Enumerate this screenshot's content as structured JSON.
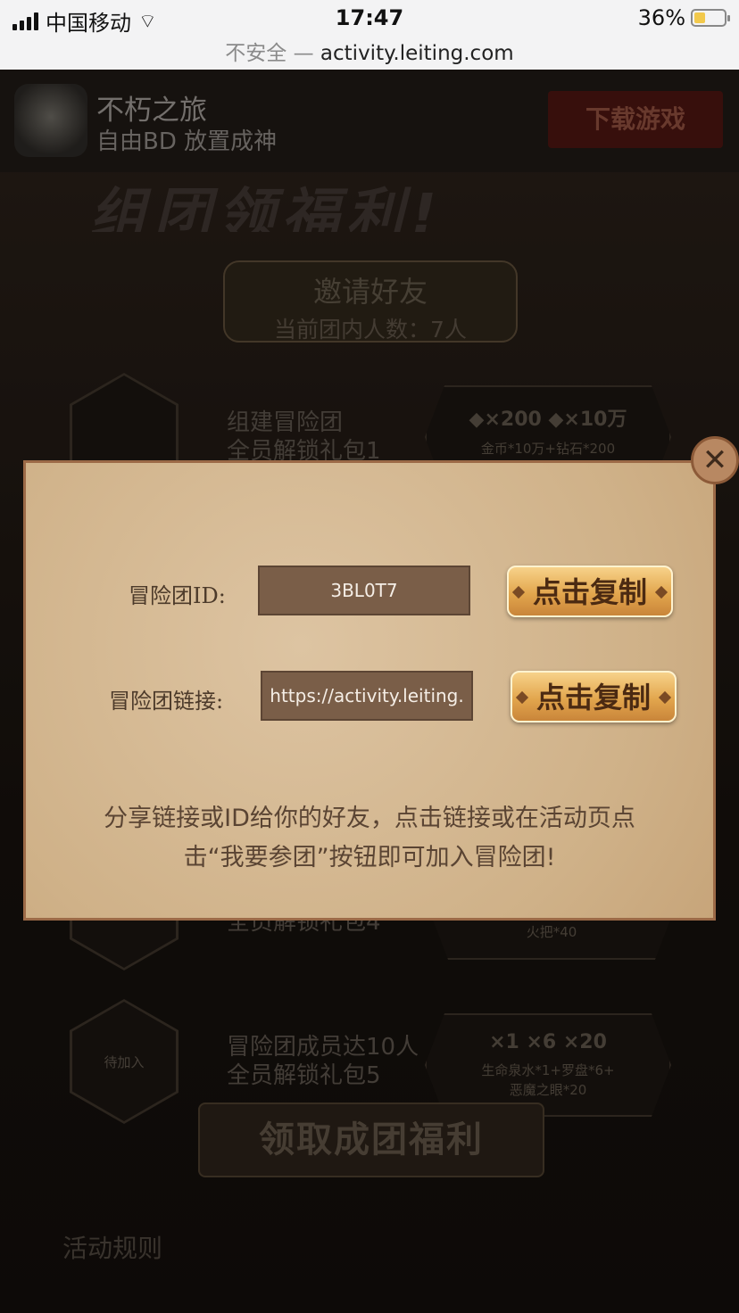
{
  "status_bar": {
    "carrier": "中国移动",
    "time": "17:47",
    "battery_text": "36%",
    "battery_level": 0.36,
    "url_insecure": "不安全",
    "url_sep": "—",
    "url_host": "activity.leiting.com"
  },
  "app_bar": {
    "name": "不朽之旅",
    "tagline": "自由BD 放置成神",
    "download_label": "下载游戏"
  },
  "background": {
    "banner": "组团领福利!",
    "invite_title": "邀请好友",
    "member_count": "当前团内人数：7人",
    "rows": [
      {
        "title": "组建冒险团",
        "subtitle": "全员解锁礼包1",
        "reward_icons": "◆×200  ◆×10万",
        "reward_desc": "金币*10万+钻石*200"
      },
      {
        "title": "",
        "subtitle": "全员解锁礼包4",
        "reward_icons": "",
        "reward_desc": "火把*40"
      },
      {
        "status": "待加入",
        "title": "冒险团成员达10人",
        "subtitle": "全员解锁礼包5",
        "reward_icons": "×1  ×6  ×20",
        "reward_desc_1": "生命泉水*1+罗盘*6+",
        "reward_desc_2": "恶魔之眼*20"
      }
    ],
    "claim_label": "领取成团福利",
    "rules_label": "活动规则"
  },
  "modal": {
    "team_id_label": "冒险团ID:",
    "team_id_value": "3BL0T7",
    "link_label": "冒险团链接:",
    "link_value": "https://activity.leiting.",
    "copy_label": "点击复制",
    "share_text_1": "分享链接或ID给你的好友，点击链接或在活动页点",
    "share_text_2": "击“我要参团”按钮即可加入冒险团!",
    "close_symbol": "✕"
  },
  "colors": {
    "modal_bg": "#d8bd98",
    "copy_button": "#e2a64d",
    "field_bg": "#7a5e48"
  }
}
